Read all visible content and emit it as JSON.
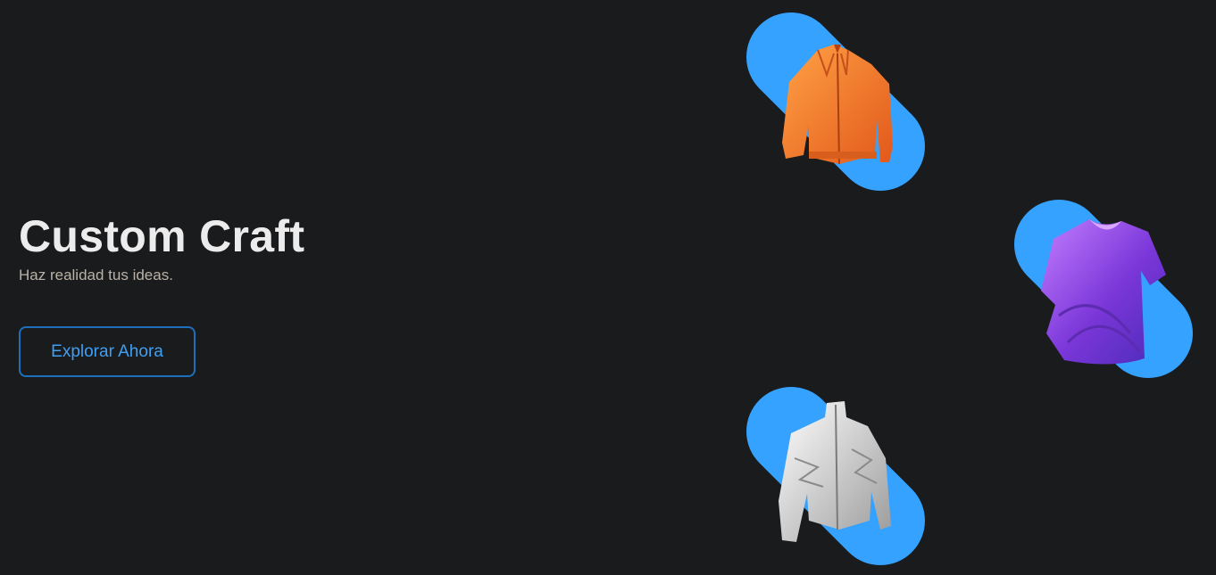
{
  "hero": {
    "title": "Custom Craft",
    "subtitle": "Haz realidad tus ideas.",
    "cta_label": "Explorar Ahora"
  },
  "products": [
    {
      "name": "orange-jacket",
      "color": "#f07a2a"
    },
    {
      "name": "purple-tshirt",
      "color": "#8b3fe0"
    },
    {
      "name": "white-jacket",
      "color": "#e6e6e6"
    }
  ],
  "colors": {
    "background": "#1a1b1d",
    "accent": "#35a2ff",
    "button_border": "#1f6fbd",
    "button_text": "#3ea0f5"
  }
}
